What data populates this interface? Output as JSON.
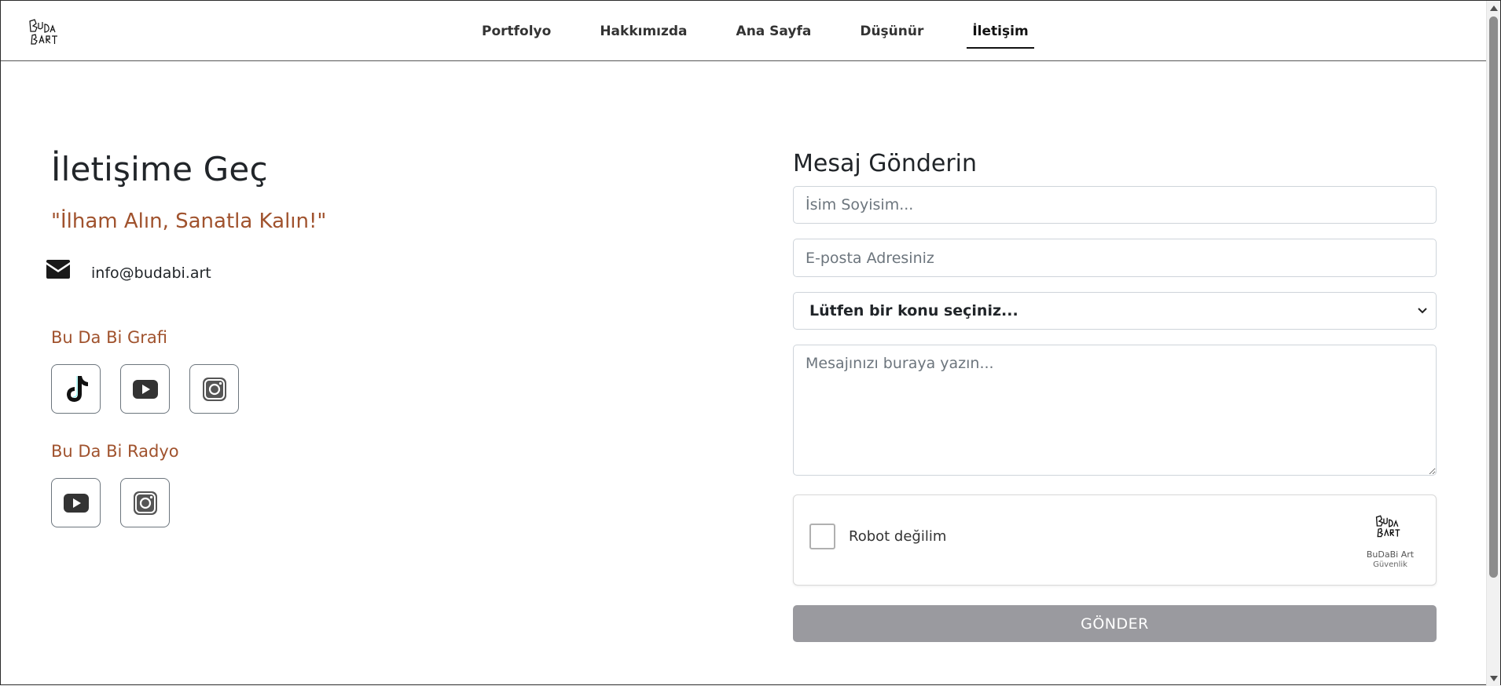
{
  "header": {
    "logo_alt": "BuDaBi Art",
    "nav": [
      {
        "label": "Portfolyo",
        "active": false
      },
      {
        "label": "Hakkımızda",
        "active": false
      },
      {
        "label": "Ana Sayfa",
        "active": false
      },
      {
        "label": "Düşünür",
        "active": false
      },
      {
        "label": "İletişim",
        "active": true
      }
    ]
  },
  "contact": {
    "title": "İletişime Geç",
    "slogan": "\"İlham Alın, Sanatla Kalın!\"",
    "email": "info@budabi.art",
    "groups": [
      {
        "label": "Bu Da Bi Grafi",
        "links": [
          "tiktok-icon",
          "youtube-icon",
          "instagram-icon"
        ]
      },
      {
        "label": "Bu Da Bi Radyo",
        "links": [
          "youtube-icon",
          "instagram-icon"
        ]
      }
    ]
  },
  "form": {
    "title": "Mesaj Gönderin",
    "name_placeholder": "İsim Soyisim...",
    "email_placeholder": "E-posta Adresiniz",
    "subject_selected": "Lütfen bir konu seçiniz...",
    "message_placeholder": "Mesajınızı buraya yazın...",
    "captcha": {
      "label": "Robot değilim",
      "brand": "BuDaBi Art",
      "sub": "Güvenlik",
      "checked": false
    },
    "submit_label": "GÖNDER"
  },
  "colors": {
    "accent": "#a0522d",
    "submit_disabled": "#9a9a9f",
    "text": "#212529"
  }
}
